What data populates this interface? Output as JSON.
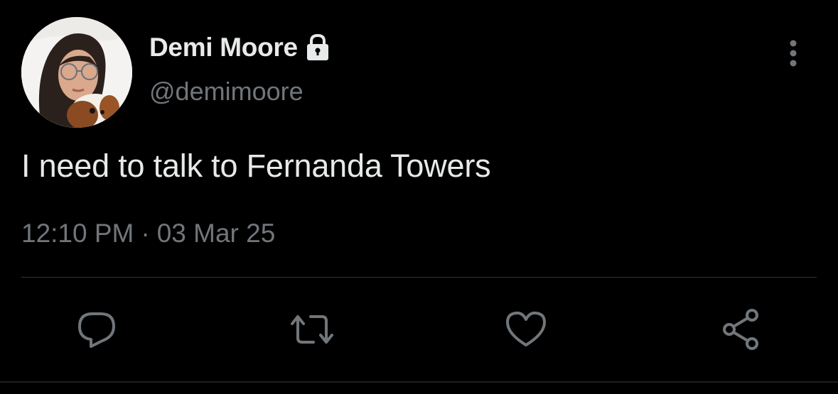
{
  "author": {
    "display_name": "Demi Moore",
    "handle": "@demimoore",
    "protected_icon": "lock-icon"
  },
  "tweet": {
    "text": "I need to talk to Fernanda Towers",
    "time": "12:10 PM",
    "separator": "·",
    "date": "03 Mar 25"
  },
  "actions": {
    "reply_icon": "reply-icon",
    "retweet_icon": "retweet-icon",
    "like_icon": "heart-icon",
    "share_icon": "share-icon",
    "more_icon": "more-vertical-icon"
  },
  "colors": {
    "background": "#000000",
    "primary_text": "#e7e9ea",
    "secondary_text": "#71767b",
    "divider": "#2f3336"
  }
}
